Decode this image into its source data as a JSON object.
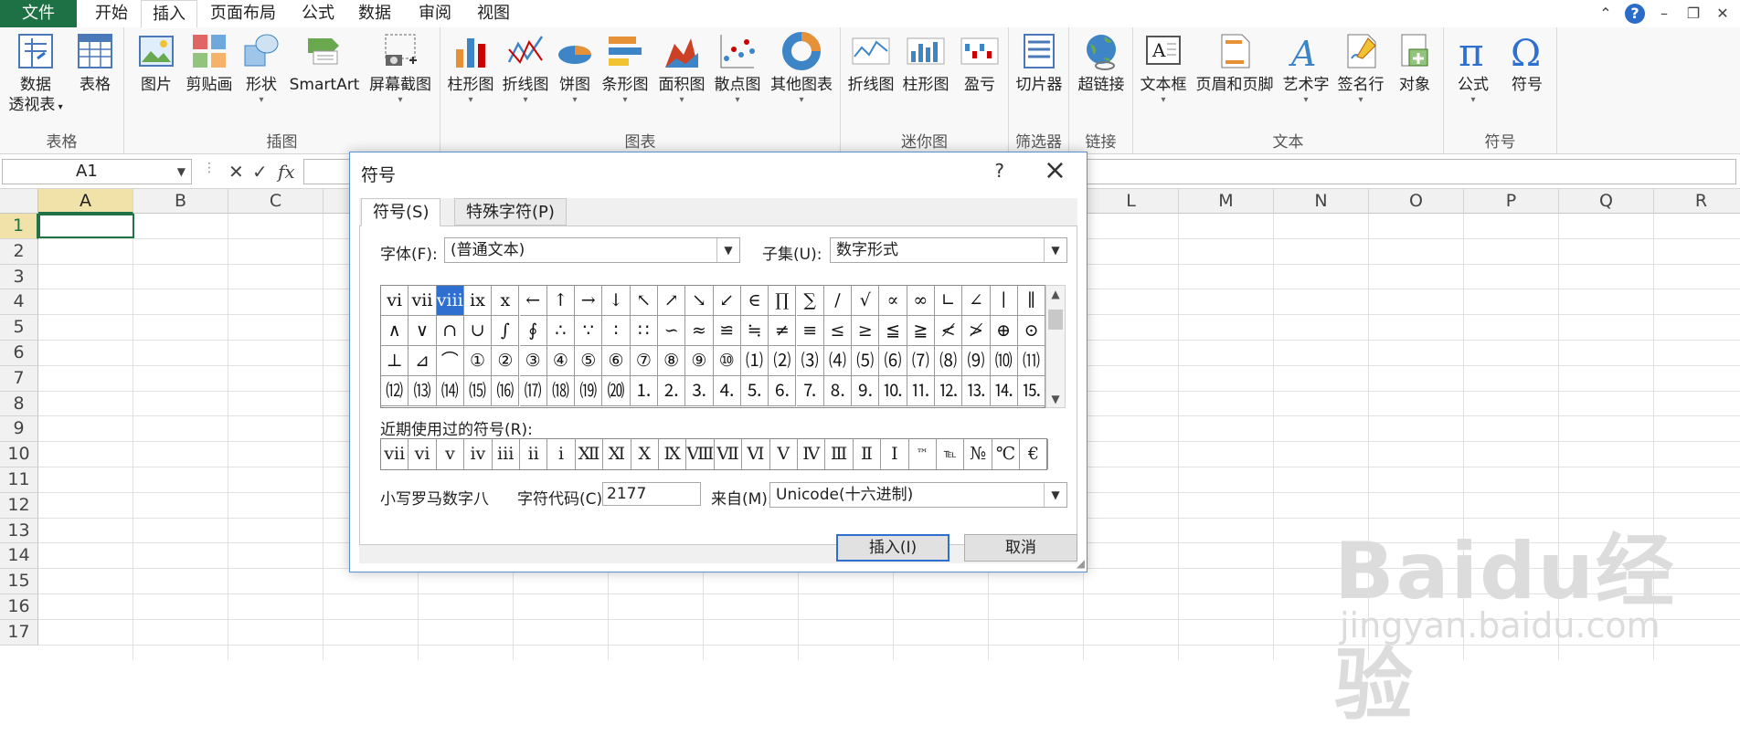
{
  "tabs": [
    {
      "label": "文件",
      "kind": "file"
    },
    {
      "label": "开始"
    },
    {
      "label": "插入",
      "active": true
    },
    {
      "label": "页面布局"
    },
    {
      "label": "公式"
    },
    {
      "label": "数据"
    },
    {
      "label": "审阅"
    },
    {
      "label": "视图"
    }
  ],
  "ribbon": {
    "groups": {
      "table": "表格",
      "illustration": "插图",
      "chart": "图表",
      "sparkline": "迷你图",
      "filter": "筛选器",
      "link": "链接",
      "text": "文本",
      "symbol": "符号"
    },
    "buttons": {
      "pivot_line1": "数据",
      "pivot_line2": "透视表",
      "table": "表格",
      "picture": "图片",
      "clipart": "剪贴画",
      "shape": "形状",
      "smartart": "SmartArt",
      "screenshot": "屏幕截图",
      "bar": "柱形图",
      "line": "折线图",
      "pie": "饼图",
      "hbar": "条形图",
      "area": "面积图",
      "scatter": "散点图",
      "other": "其他图表",
      "spark_line": "折线图",
      "spark_bar": "柱形图",
      "spark_winloss": "盈亏",
      "slicer": "切片器",
      "hyperlink": "超链接",
      "textbox": "文本框",
      "headerfooter": "页眉和页脚",
      "wordart": "艺术字",
      "signature": "签名行",
      "object": "对象",
      "equation": "公式",
      "symbol": "符号"
    }
  },
  "formula_bar": {
    "cell_ref": "A1"
  },
  "grid": {
    "columns": [
      "A",
      "B",
      "C",
      "D",
      "E",
      "F",
      "G",
      "H",
      "I",
      "J",
      "K",
      "L",
      "M",
      "N",
      "O",
      "P",
      "Q",
      "R"
    ],
    "rows": [
      "1",
      "2",
      "3",
      "4",
      "5",
      "6",
      "7",
      "8",
      "9",
      "10",
      "11",
      "12",
      "13",
      "14",
      "15",
      "16",
      "17"
    ]
  },
  "watermark": {
    "logo": "Baidu经验",
    "url": "jingyan.baidu.com"
  },
  "dialog": {
    "title": "符号",
    "help": "?",
    "tab_symbols": "符号(S)",
    "tab_special": "特殊字符(P)",
    "font_label": "字体(F):",
    "font_value": "(普通文本)",
    "subset_label": "子集(U):",
    "subset_value": "数字形式",
    "symbols": [
      [
        "ⅵ",
        "ⅶ",
        "ⅷ",
        "ⅸ",
        "ⅹ",
        "←",
        "↑",
        "→",
        "↓",
        "↖",
        "↗",
        "↘",
        "↙",
        "∈",
        "∏",
        "∑",
        "∕",
        "√",
        "∝",
        "∞",
        "∟",
        "∠",
        "∣",
        "∥"
      ],
      [
        "∧",
        "∨",
        "∩",
        "∪",
        "∫",
        "∮",
        "∴",
        "∵",
        "∶",
        "∷",
        "∽",
        "≈",
        "≌",
        "≒",
        "≠",
        "≡",
        "≤",
        "≥",
        "≦",
        "≧",
        "≮",
        "≯",
        "⊕",
        "⊙"
      ],
      [
        "⊥",
        "⊿",
        "⌒",
        "①",
        "②",
        "③",
        "④",
        "⑤",
        "⑥",
        "⑦",
        "⑧",
        "⑨",
        "⑩",
        "⑴",
        "⑵",
        "⑶",
        "⑷",
        "⑸",
        "⑹",
        "⑺",
        "⑻",
        "⑼",
        "⑽",
        "⑾"
      ],
      [
        "⑿",
        "⒀",
        "⒁",
        "⒂",
        "⒃",
        "⒄",
        "⒅",
        "⒆",
        "⒇",
        "⒈",
        "⒉",
        "⒊",
        "⒋",
        "⒌",
        "⒍",
        "⒎",
        "⒏",
        "⒐",
        "⒑",
        "⒒",
        "⒓",
        "⒔",
        "⒕",
        "⒖"
      ]
    ],
    "recent_label": "近期使用过的符号(R):",
    "recent": [
      "ⅶ",
      "ⅵ",
      "ⅴ",
      "ⅳ",
      "ⅲ",
      "ⅱ",
      "ⅰ",
      "Ⅻ",
      "Ⅺ",
      "Ⅹ",
      "Ⅸ",
      "Ⅷ",
      "Ⅶ",
      "Ⅵ",
      "Ⅴ",
      "Ⅳ",
      "Ⅲ",
      "Ⅱ",
      "Ⅰ",
      "™",
      "℡",
      "№",
      "℃",
      "€"
    ],
    "char_name": "小写罗马数字八",
    "code_label": "字符代码(C):",
    "code_value": "2177",
    "from_label": "来自(M):",
    "from_value": "Unicode(十六进制)",
    "insert_label": "插入(I)",
    "cancel_label": "取消"
  },
  "colors": {
    "excel_green": "#1e7145",
    "select_blue": "#2f6fd0"
  }
}
